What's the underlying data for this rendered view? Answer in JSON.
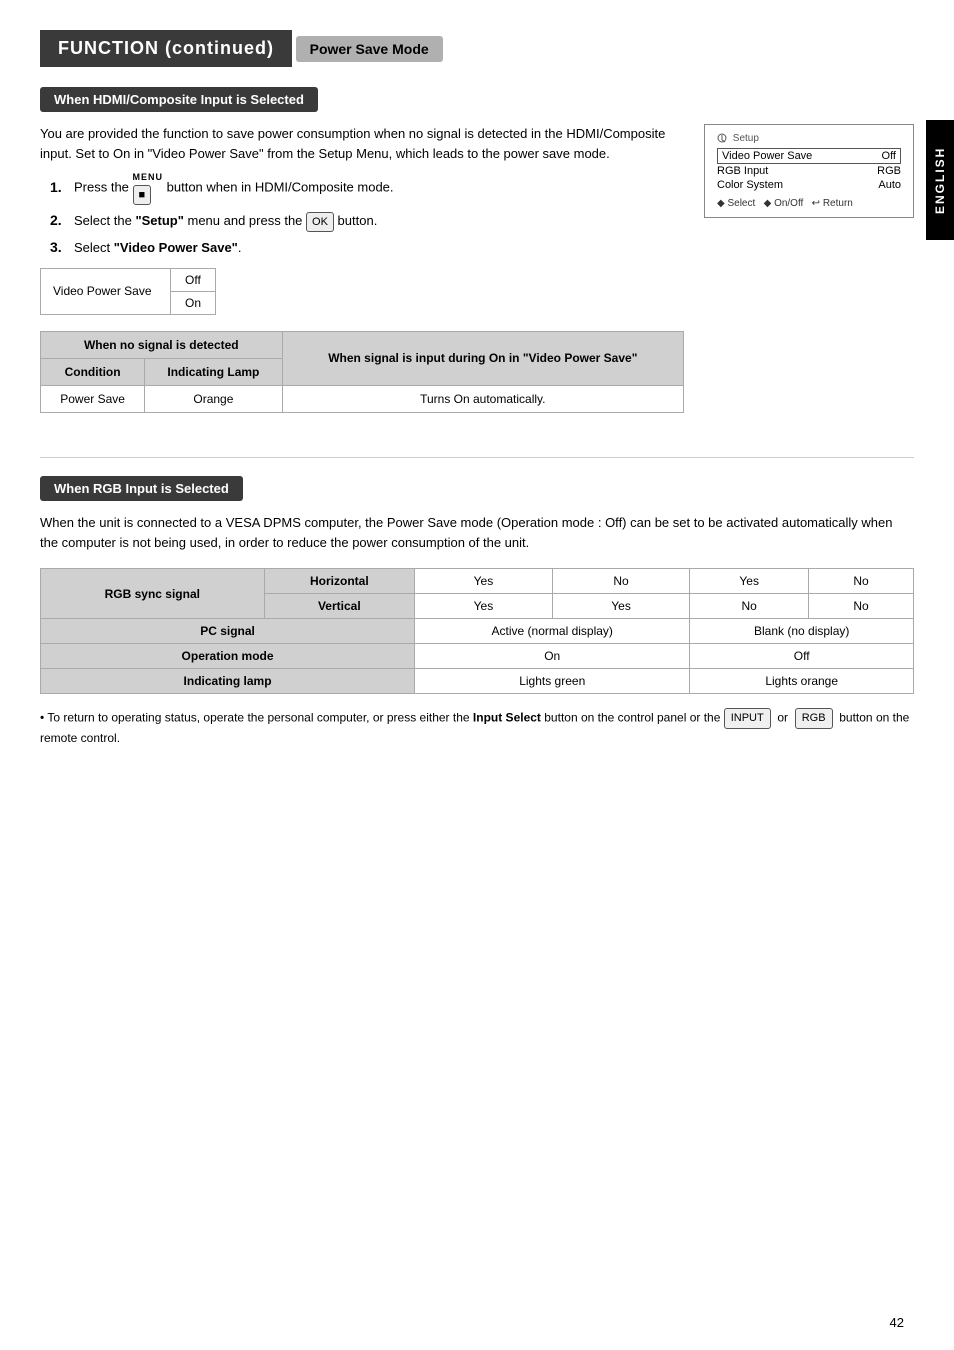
{
  "main_title": "FUNCTION (continued)",
  "section_title": "Power Save Mode",
  "side_tab": "ENGLISH",
  "hdmi_section": {
    "heading": "When HDMI/Composite Input is Selected",
    "description": "You are provided the function to save power consumption when no signal is detected in the HDMI/Composite input. Set to On in \"Video Power Save\" from the Setup Menu, which leads to the power save mode.",
    "steps": [
      {
        "num": "1.",
        "text_before": "Press the",
        "icon": "■",
        "text_after": "button when in HDMI/Composite mode.",
        "label_above": "MENU"
      },
      {
        "num": "2.",
        "text_before": "Select the",
        "bold": "\"Setup\"",
        "text_middle": "menu and press the",
        "icon": "OK",
        "text_after": "button."
      },
      {
        "num": "3.",
        "text_before": "Select",
        "bold": "\"Video Power Save\"",
        "text_after": "."
      }
    ],
    "options_label": "Video Power Save",
    "options": [
      "Off",
      "On"
    ],
    "signal_table": {
      "col1_header": "When no signal is detected",
      "col2_header": "When signal is input during On in \"Video Power Save\"",
      "sub_headers": [
        "Condition",
        "Indicating Lamp"
      ],
      "rows": [
        {
          "condition": "Power Save",
          "lamp": "Orange",
          "when_signal": "Turns On automatically."
        }
      ]
    },
    "osd": {
      "title": "Setup",
      "rows": [
        {
          "label": "Video Power Save",
          "value": "Off",
          "selected": true
        },
        {
          "label": "RGB Input",
          "value": "RGB"
        },
        {
          "label": "Color System",
          "value": "Auto"
        }
      ],
      "footer": "◆ Select   ◆ On/Off   ↩ Return"
    }
  },
  "rgb_section": {
    "heading": "When RGB Input is Selected",
    "description": "When the unit is connected to a VESA DPMS computer, the Power Save mode (Operation mode : Off) can be set to be activated automatically when the computer is not being used, in order to reduce the power consumption of the unit.",
    "table": {
      "rows": [
        {
          "header": "RGB sync signal",
          "sub": "Horizontal",
          "values": [
            "Yes",
            "No",
            "Yes",
            "No"
          ]
        },
        {
          "header": "",
          "sub": "Vertical",
          "values": [
            "Yes",
            "Yes",
            "No",
            "No"
          ]
        },
        {
          "header": "PC signal",
          "sub": "",
          "values_span": [
            "Active (normal display)",
            "Blank (no display)"
          ]
        },
        {
          "header": "Operation mode",
          "sub": "",
          "values_span": [
            "On",
            "Off"
          ]
        },
        {
          "header": "Indicating lamp",
          "sub": "",
          "values_span": [
            "Lights green",
            "Lights orange"
          ]
        }
      ]
    },
    "note": "• To return to operating status, operate the personal computer, or press either the Input Select button on the control panel or the",
    "note_keys": [
      "INPUT",
      "RGB"
    ],
    "note_end": "button on the remote control."
  },
  "page_number": "42"
}
